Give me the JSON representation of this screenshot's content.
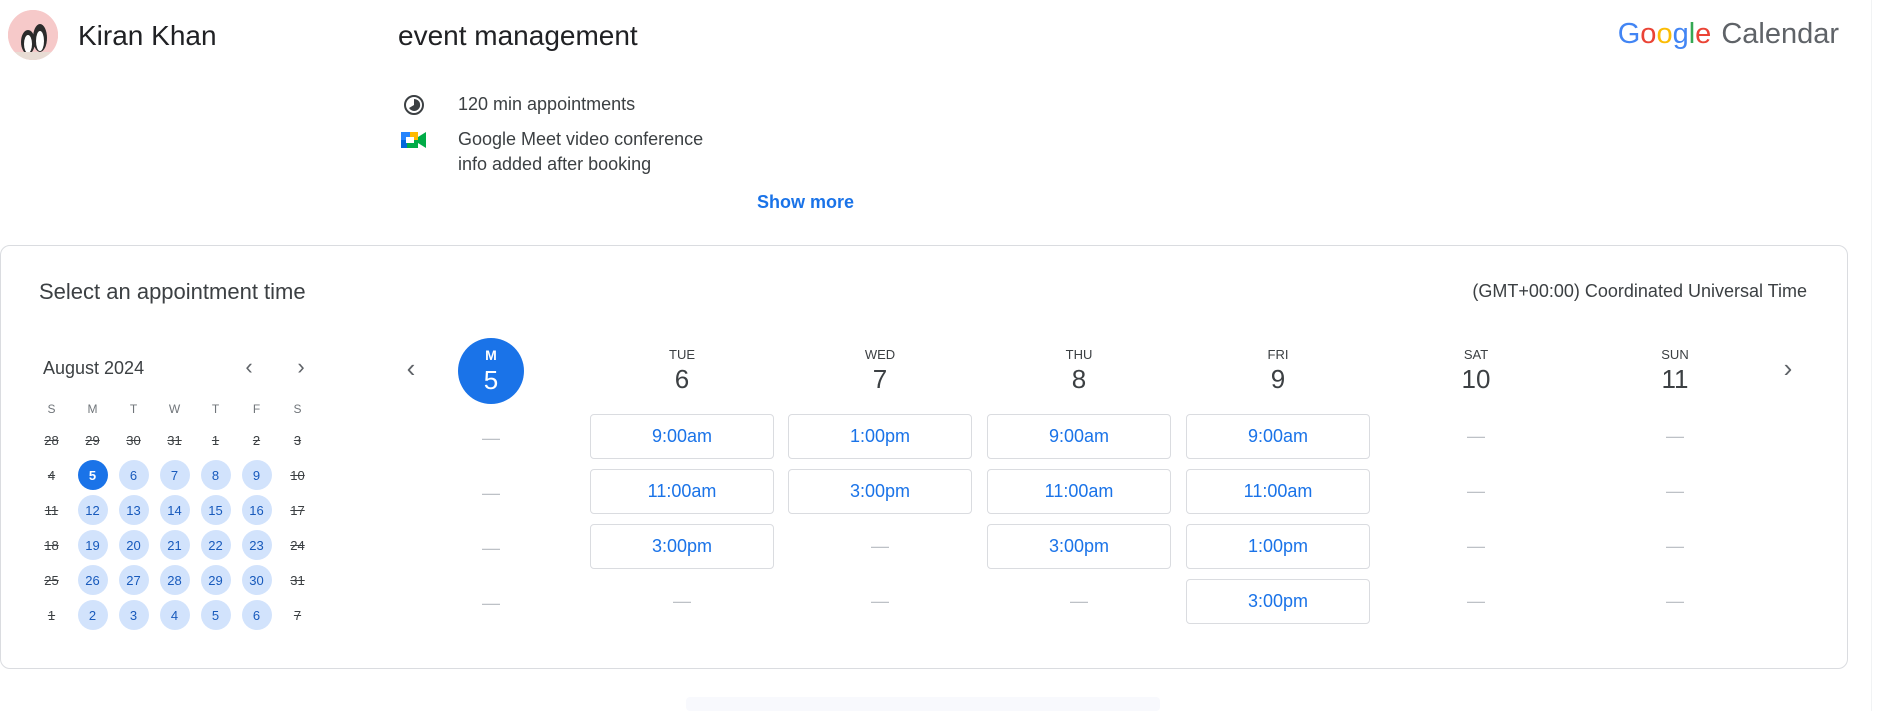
{
  "header": {
    "owner_name": "Kiran Khan",
    "event_title": "event management",
    "brand": {
      "g": [
        "G",
        "o",
        "o",
        "g",
        "l",
        "e"
      ],
      "product": "Calendar"
    }
  },
  "details": {
    "duration": "120 min appointments",
    "conference_line1": "Google Meet video conference",
    "conference_line2": "info added after booking",
    "show_more": "Show more"
  },
  "booking": {
    "title": "Select an appointment time",
    "timezone": "(GMT+00:00) Coordinated Universal Time"
  },
  "mini_calendar": {
    "month": "August 2024",
    "weekdays": [
      "S",
      "M",
      "T",
      "W",
      "T",
      "F",
      "S"
    ],
    "weeks": [
      [
        {
          "d": "28",
          "s": "past"
        },
        {
          "d": "29",
          "s": "past"
        },
        {
          "d": "30",
          "s": "past"
        },
        {
          "d": "31",
          "s": "past"
        },
        {
          "d": "1",
          "s": "past"
        },
        {
          "d": "2",
          "s": "past"
        },
        {
          "d": "3",
          "s": "past"
        }
      ],
      [
        {
          "d": "4",
          "s": "past"
        },
        {
          "d": "5",
          "s": "sel"
        },
        {
          "d": "6",
          "s": "avail"
        },
        {
          "d": "7",
          "s": "avail"
        },
        {
          "d": "8",
          "s": "avail"
        },
        {
          "d": "9",
          "s": "avail"
        },
        {
          "d": "10",
          "s": "past"
        }
      ],
      [
        {
          "d": "11",
          "s": "past"
        },
        {
          "d": "12",
          "s": "avail"
        },
        {
          "d": "13",
          "s": "avail"
        },
        {
          "d": "14",
          "s": "avail"
        },
        {
          "d": "15",
          "s": "avail"
        },
        {
          "d": "16",
          "s": "avail"
        },
        {
          "d": "17",
          "s": "past"
        }
      ],
      [
        {
          "d": "18",
          "s": "past"
        },
        {
          "d": "19",
          "s": "avail"
        },
        {
          "d": "20",
          "s": "avail"
        },
        {
          "d": "21",
          "s": "avail"
        },
        {
          "d": "22",
          "s": "avail"
        },
        {
          "d": "23",
          "s": "avail"
        },
        {
          "d": "24",
          "s": "past"
        }
      ],
      [
        {
          "d": "25",
          "s": "past"
        },
        {
          "d": "26",
          "s": "avail"
        },
        {
          "d": "27",
          "s": "avail"
        },
        {
          "d": "28",
          "s": "avail"
        },
        {
          "d": "29",
          "s": "avail"
        },
        {
          "d": "30",
          "s": "avail"
        },
        {
          "d": "31",
          "s": "past"
        }
      ],
      [
        {
          "d": "1",
          "s": "past"
        },
        {
          "d": "2",
          "s": "avail"
        },
        {
          "d": "3",
          "s": "avail"
        },
        {
          "d": "4",
          "s": "avail"
        },
        {
          "d": "5",
          "s": "avail"
        },
        {
          "d": "6",
          "s": "avail"
        },
        {
          "d": "7",
          "s": "past"
        }
      ]
    ]
  },
  "week": {
    "days": [
      {
        "name": "M",
        "num": "5",
        "selected": true,
        "slots": [
          "—",
          "—",
          "—",
          "—"
        ]
      },
      {
        "name": "TUE",
        "num": "6",
        "slots": [
          "9:00am",
          "11:00am",
          "3:00pm",
          "—"
        ]
      },
      {
        "name": "WED",
        "num": "7",
        "slots": [
          "1:00pm",
          "3:00pm",
          "—",
          "—"
        ]
      },
      {
        "name": "THU",
        "num": "8",
        "slots": [
          "9:00am",
          "11:00am",
          "3:00pm",
          "—"
        ]
      },
      {
        "name": "FRI",
        "num": "9",
        "slots": [
          "9:00am",
          "11:00am",
          "1:00pm",
          "3:00pm"
        ]
      },
      {
        "name": "SAT",
        "num": "10",
        "slots": [
          "—",
          "—",
          "—",
          "—"
        ]
      },
      {
        "name": "SUN",
        "num": "11",
        "slots": [
          "—",
          "—",
          "—",
          "—"
        ]
      }
    ]
  },
  "colors": {
    "accent": "#1a73e8",
    "available_day": "#d2e3fc",
    "border": "#dadce0"
  },
  "icons": {
    "duration": "clock-half-icon",
    "conference": "google-meet-icon",
    "prev": "chevron-left-icon",
    "next": "chevron-right-icon"
  }
}
